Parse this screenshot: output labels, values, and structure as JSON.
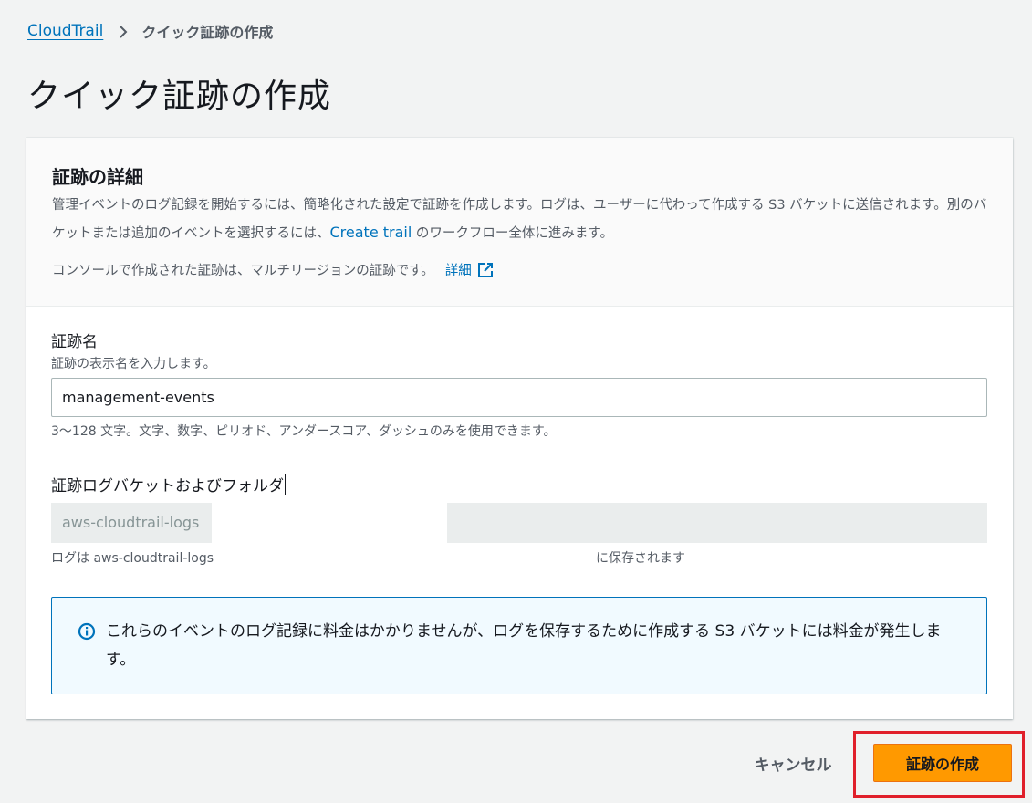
{
  "breadcrumb": {
    "root": "CloudTrail",
    "current": "クイック証跡の作成"
  },
  "page": {
    "title": "クイック証跡の作成"
  },
  "panel": {
    "header_title": "証跡の詳細",
    "desc_part1": "管理イベントのログ記録を開始するには、簡略化された設定で証跡を作成します。ログは、ユーザーに代わって作成する S3 バケットに送信されます。別のバケットまたは追加のイベントを選択するには、",
    "desc_link": "Create trail",
    "desc_part2": " のワークフロー全体に進みます。",
    "note": "コンソールで作成された証跡は、マルチリージョンの証跡です。",
    "note_link": "詳細"
  },
  "trail_name": {
    "label": "証跡名",
    "description": "証跡の表示名を入力します。",
    "value": "management-events",
    "constraint": "3～128 文字。文字、数字、ピリオド、アンダースコア、ダッシュのみを使用できます。"
  },
  "bucket": {
    "label": "証跡ログバケットおよびフォルダ",
    "value": "aws-cloudtrail-logs",
    "note_left": "ログは aws-cloudtrail-logs",
    "note_right": "に保存されます"
  },
  "info_alert": {
    "text": "これらのイベントのログ記録に料金はかかりませんが、ログを保存するために作成する S3 バケットには料金が発生します。"
  },
  "actions": {
    "cancel_label": "キャンセル",
    "create_label": "証跡の作成"
  },
  "colors": {
    "link": "#0073bb",
    "primary_button": "#ff9900",
    "highlight": "#e0202b",
    "info_border": "#0073bb"
  },
  "icons": {
    "breadcrumb_separator": "chevron-right-icon",
    "external_link": "external-link-icon",
    "info": "info-circle-icon"
  }
}
